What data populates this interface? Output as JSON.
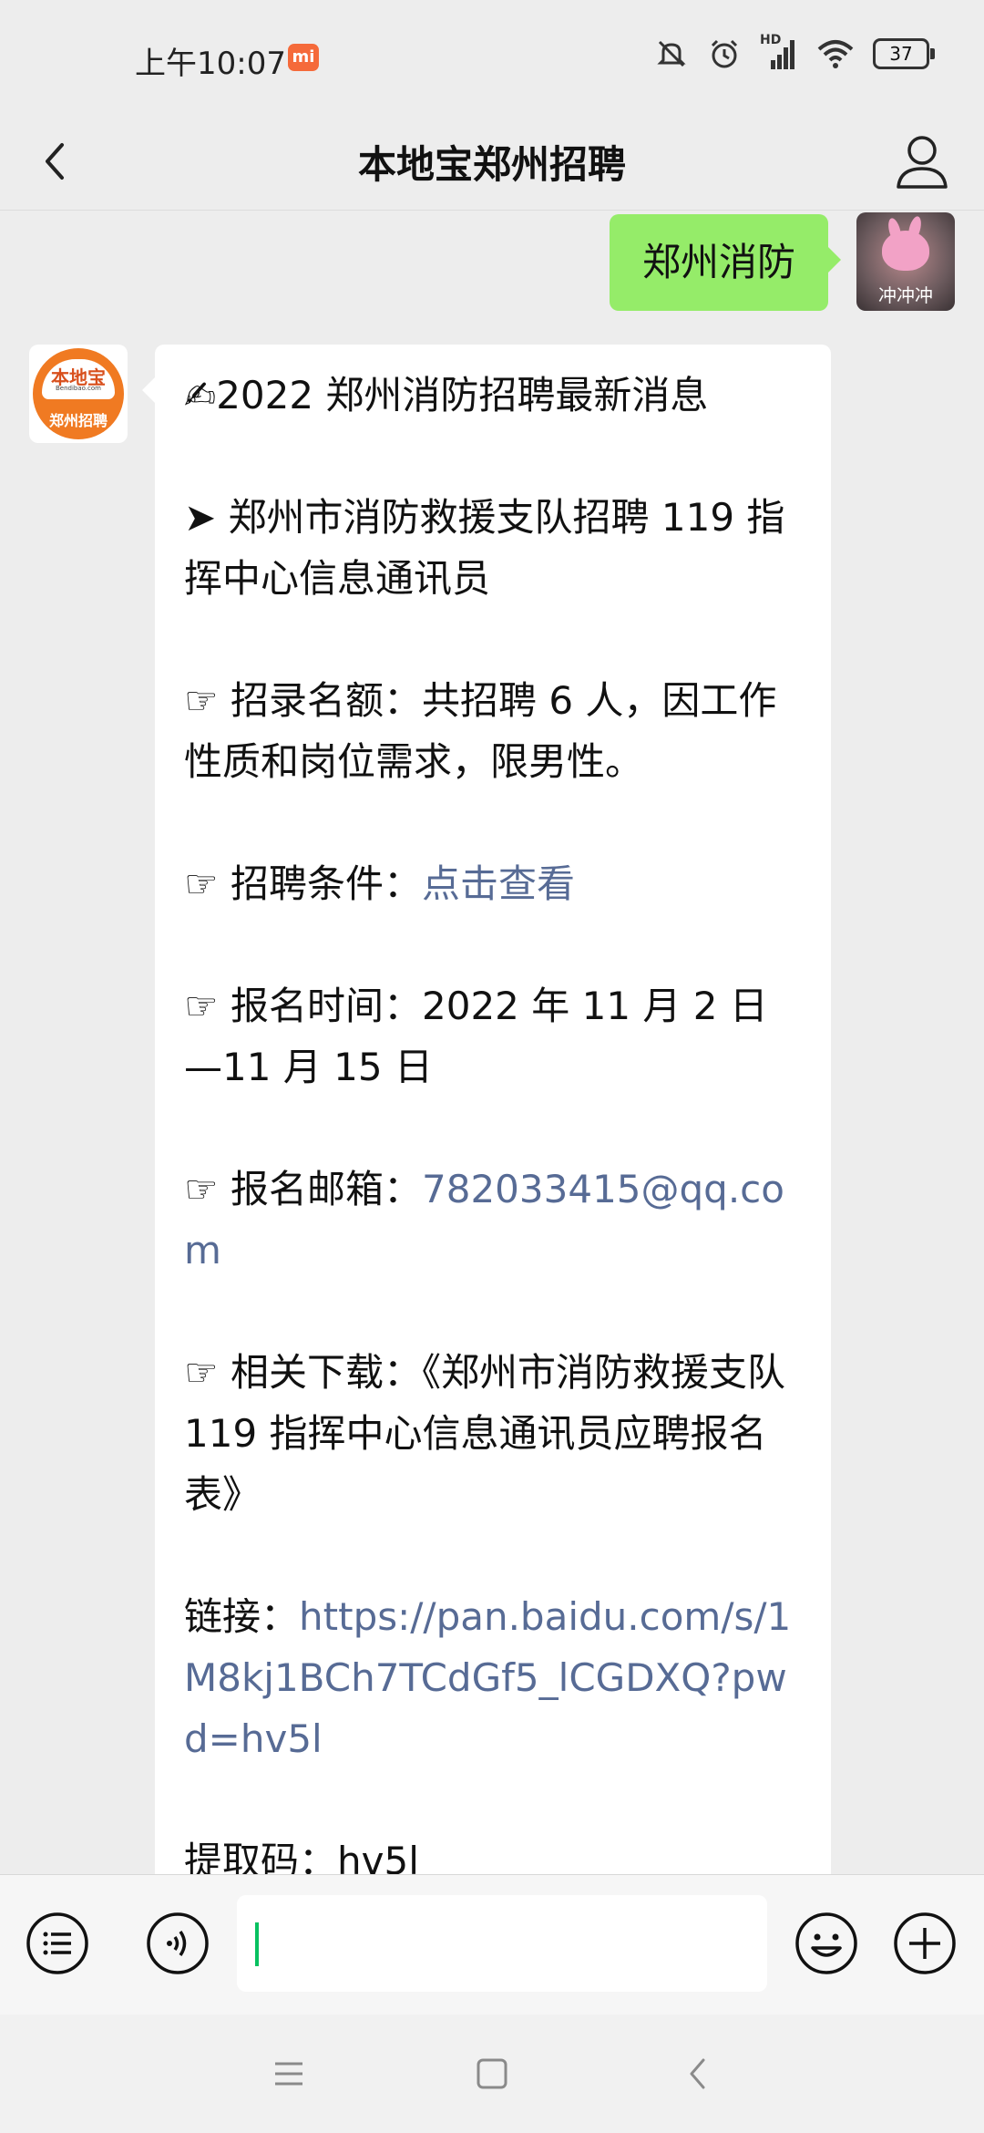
{
  "status_bar": {
    "time": "上午10:07",
    "mi_badge": "mi",
    "hd_label": "HD",
    "battery": "37"
  },
  "header": {
    "title": "本地宝郑州招聘"
  },
  "chat": {
    "outgoing_message": "郑州消防",
    "user_avatar_caption": "冲冲冲",
    "bot_avatar": {
      "brand": "本地宝",
      "site": "Bendibao.com",
      "sub": "郑州招聘"
    },
    "incoming": {
      "headline": "✍2022 郑州消防招聘最新消息",
      "intro": "➤ 郑州市消防救援支队招聘 119 指挥中心信息通讯员",
      "quota": "☞ 招录名额：共招聘 6 人，因工作性质和岗位需求，限男性。",
      "conditions_label": "☞ 招聘条件：",
      "conditions_link": "点击查看",
      "time": "☞ 报名时间：2022 年 11 月 2 日—11 月 15 日",
      "email_label": "☞ 报名邮箱：",
      "email_link": "782033415@qq.com",
      "download": "☞ 相关下载：《郑州市消防救援支队 119 指挥中心信息通讯员应聘报名表》",
      "link_label": "链接：",
      "link_url": "https://pan.baidu.com/s/1M8kj1BCh7TCdGf5_lCGDXQ?pwd=hv5l",
      "code": "提取码：hv5l"
    }
  },
  "input_bar": {
    "value": ""
  },
  "colors": {
    "background": "#ededed",
    "outgoing_bubble": "#95ec69",
    "link": "#576b95",
    "caret": "#07c160",
    "brand_orange": "#f07a22"
  },
  "icons": [
    "back-arrow-icon",
    "user-profile-icon",
    "menu-list-icon",
    "voice-icon",
    "emoji-icon",
    "plus-icon",
    "nav-menu-icon",
    "nav-home-icon",
    "nav-back-icon",
    "mute-icon",
    "alarm-icon",
    "signal-icon",
    "wifi-icon",
    "battery-icon"
  ]
}
